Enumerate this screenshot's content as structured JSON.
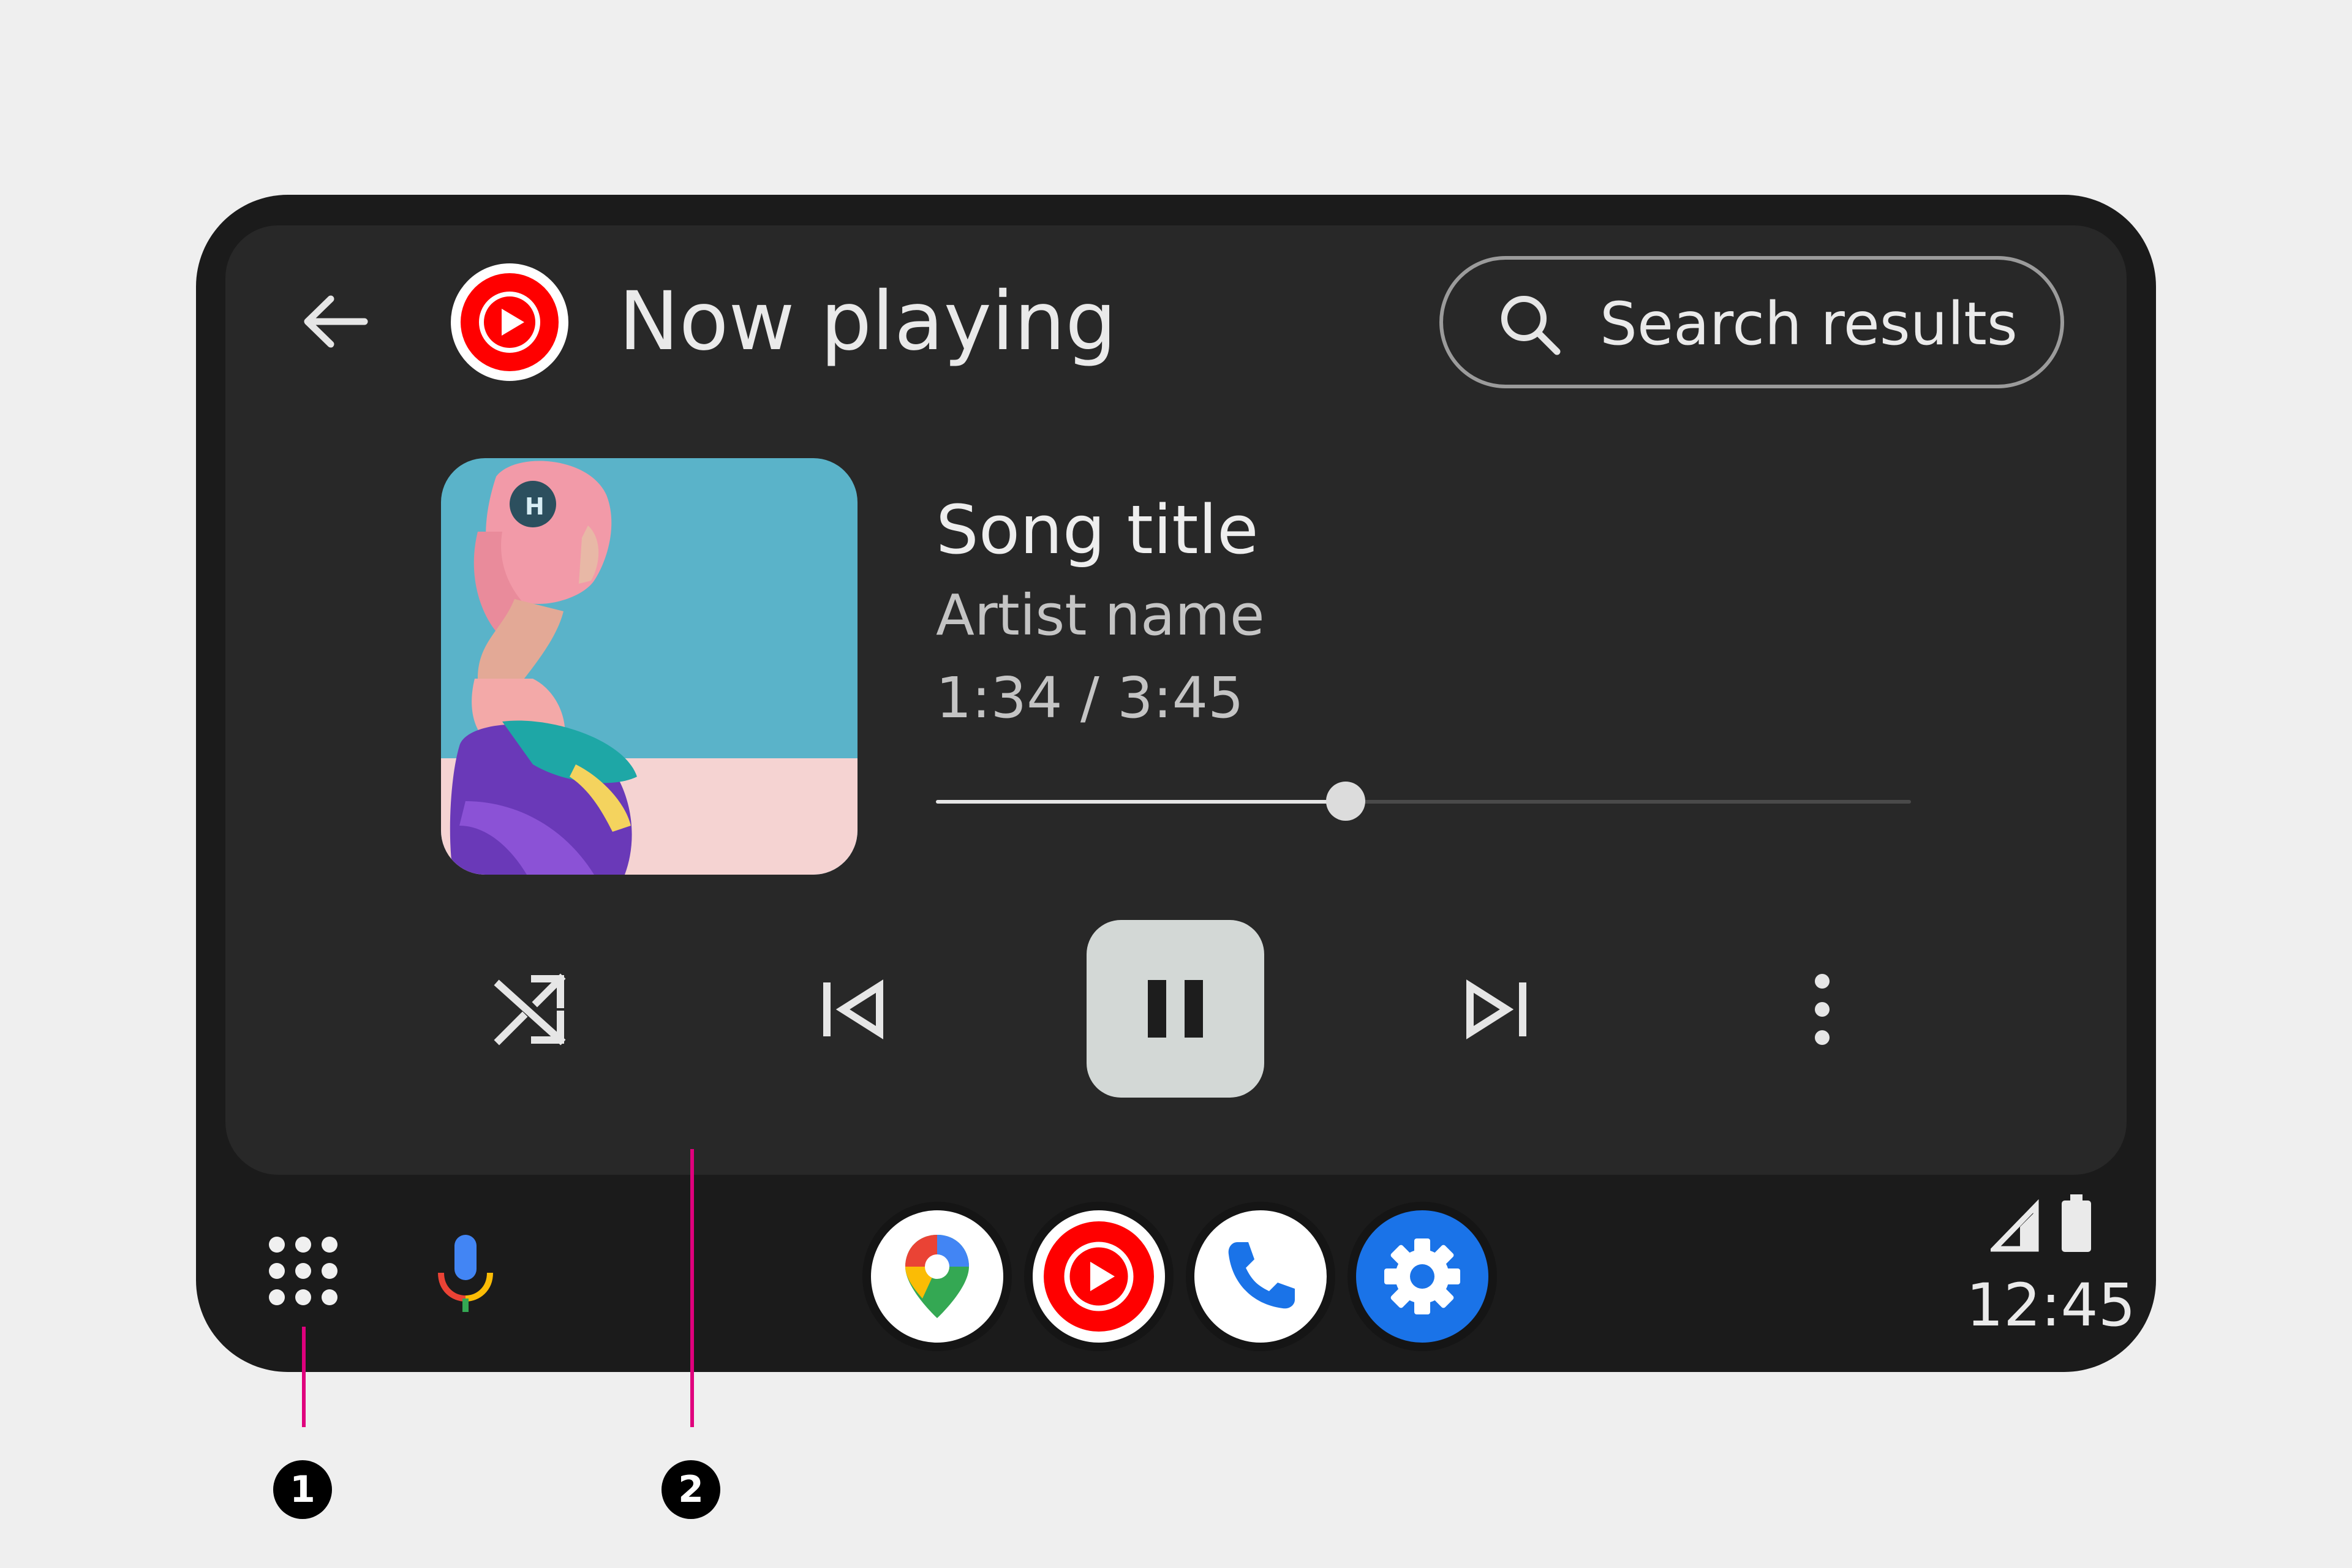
{
  "header": {
    "title": "Now playing",
    "search_label": "Search results"
  },
  "track": {
    "title": "Song title",
    "artist": "Artist name",
    "time": "1:34 / 3:45",
    "progress": 0.42
  },
  "status": {
    "clock": "12:45"
  },
  "callouts": [
    "1",
    "2"
  ],
  "colors": {
    "app_background": "#282828",
    "device_frame": "#1b1b1b",
    "youtube_red": "#ff0000",
    "settings_blue": "#1a73e8",
    "callout_line": "#e0007d",
    "pause_button": "#d3d8d6"
  },
  "icons": {
    "back": "arrow-left-icon",
    "app": "youtube-music-icon",
    "search": "search-icon",
    "shuffle": "shuffle-icon",
    "previous": "skip-previous-icon",
    "pause": "pause-icon",
    "next": "skip-next-icon",
    "more": "more-vert-icon",
    "launcher": "app-grid-icon",
    "assistant": "microphone-icon",
    "dock": [
      "google-maps-icon",
      "youtube-music-icon",
      "phone-icon",
      "settings-icon"
    ],
    "signal": "cell-signal-icon",
    "battery": "battery-icon"
  }
}
